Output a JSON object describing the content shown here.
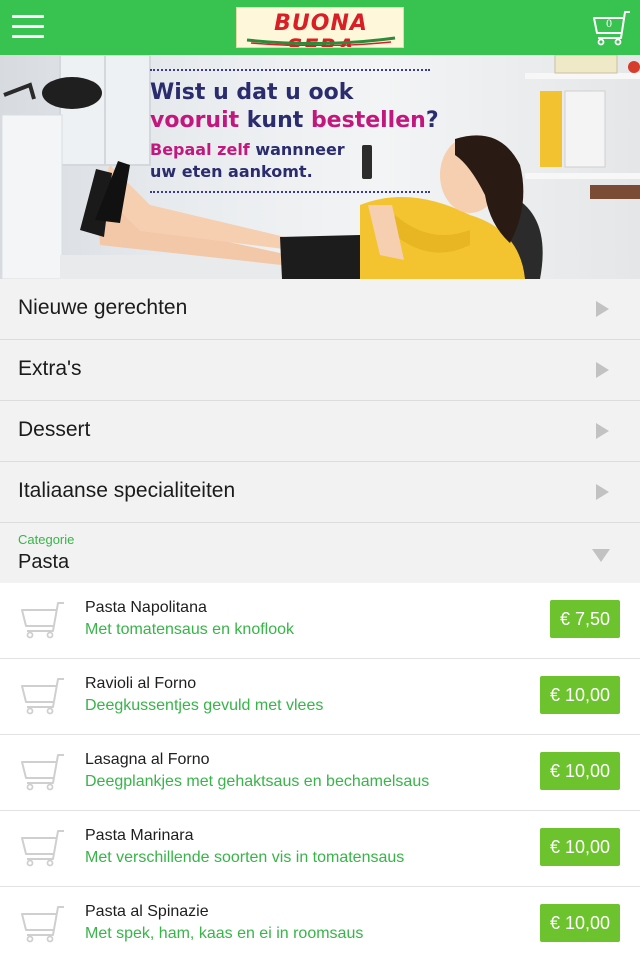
{
  "header": {
    "logo_text": "BUONA SERA",
    "cart_count": "0",
    "menu_icon": "hamburger-icon",
    "cart_icon": "cart-icon",
    "background_color": "#38c351"
  },
  "banner": {
    "line1": "Wist u dat u ook",
    "line2_a": "vooruit",
    "line2_b": " kunt ",
    "line2_c": "bestellen",
    "line2_d": "?",
    "line3_a": "Bepaal zelf",
    "line3_b": " wannneer",
    "line4": "uw eten aankomt."
  },
  "categories": [
    {
      "label": "Nieuwe gerechten"
    },
    {
      "label": "Extra's"
    },
    {
      "label": "Dessert"
    },
    {
      "label": "Italiaanse specialiteiten"
    }
  ],
  "category_select": {
    "caption": "Categorie",
    "value": "Pasta"
  },
  "products": [
    {
      "name": "Pasta Napolitana",
      "description": "Met tomatensaus en knoflook",
      "price": "€ 7,50"
    },
    {
      "name": "Ravioli al Forno",
      "description": "Deegkussentjes gevuld met vlees",
      "price": "€ 10,00"
    },
    {
      "name": "Lasagna al Forno",
      "description": "Deegplankjes met gehaktsaus en bechamelsaus",
      "price": "€ 10,00"
    },
    {
      "name": "Pasta Marinara",
      "description": "Met verschillende soorten vis in tomatensaus",
      "price": "€ 10,00"
    },
    {
      "name": "Pasta al Spinazie",
      "description": "Met spek, ham, kaas en ei in roomsaus",
      "price": "€ 10,00"
    }
  ],
  "colors": {
    "brand_green": "#38c351",
    "accent_green_text": "#38b449",
    "price_badge": "#6dc32d",
    "row_background": "#f2f2f2"
  }
}
